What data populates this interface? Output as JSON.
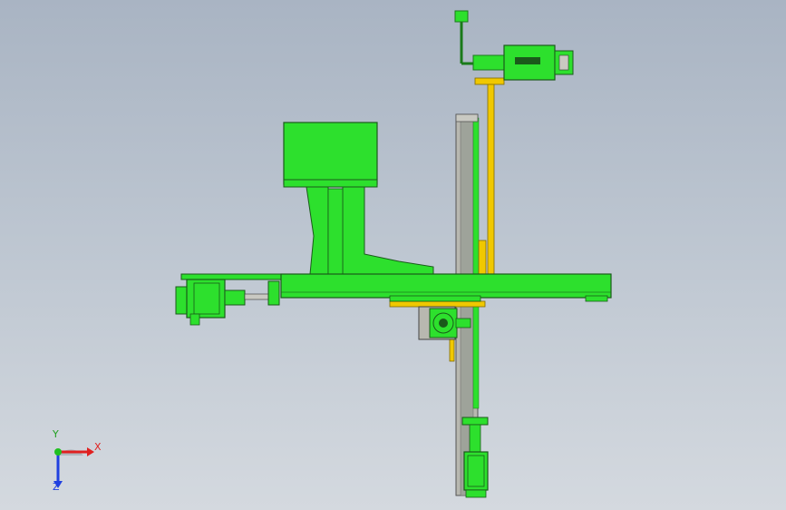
{
  "window": {
    "title": "",
    "background_top": "#a9b4c3",
    "background_bottom": "#d4d9df"
  },
  "model": {
    "primary_color": "#2de02d",
    "primary_stroke": "#1a7a1a",
    "accent_color": "#f0c800",
    "rail_color": "#b8b8b0",
    "motor_dark": "#1a5a1a"
  },
  "triad": {
    "x_label": "X",
    "y_label": "Y",
    "z_label": "Z",
    "x_color": "#e02020",
    "y_color": "#20c020",
    "z_color": "#2040e0"
  }
}
